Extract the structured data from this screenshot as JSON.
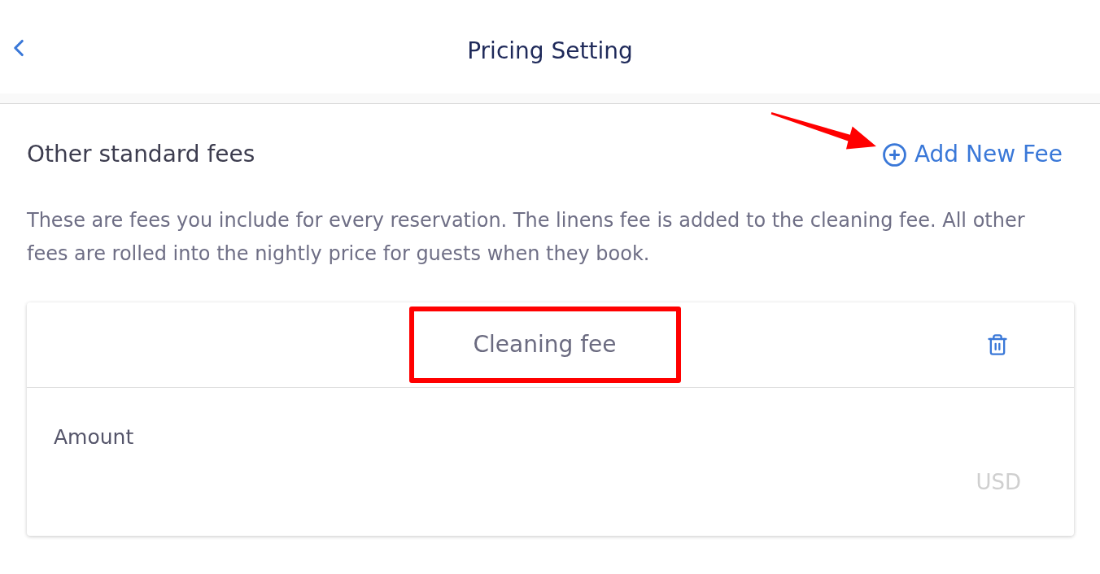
{
  "header": {
    "title": "Pricing Setting"
  },
  "section": {
    "title": "Other standard fees",
    "add_button": {
      "label": "Add New Fee",
      "pointed_at": true
    },
    "description": "These are fees you include for every reservation. The linens fee is added to the cleaning fee. All other fees are rolled into the nightly price for guests when they book."
  },
  "fees": [
    {
      "name": "Cleaning fee",
      "highlighted": true,
      "amount": {
        "label": "Amount",
        "placeholder": "USD"
      }
    }
  ]
}
